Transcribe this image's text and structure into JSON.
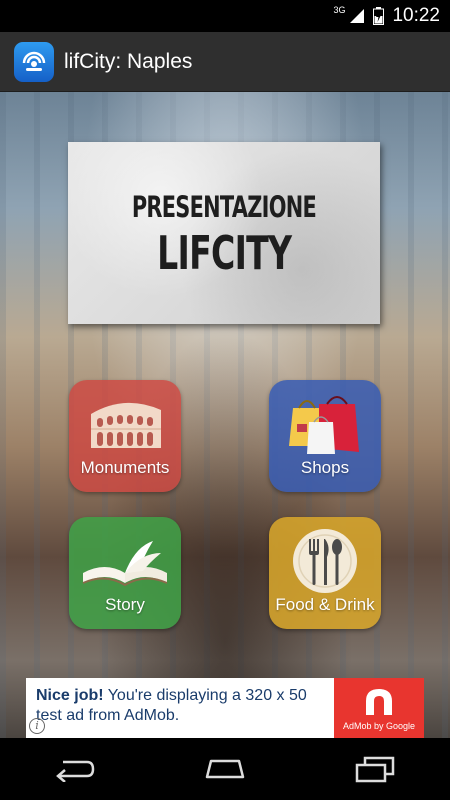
{
  "status_bar": {
    "network": "3G",
    "time": "10:22"
  },
  "app": {
    "title": "lifCity: Naples"
  },
  "presentation": {
    "line1": "PRESENTAZIONE",
    "line2": "LIFCITY"
  },
  "tiles": [
    {
      "label": "Monuments",
      "icon": "colosseum-icon",
      "color": "#ce4842"
    },
    {
      "label": "Shops",
      "icon": "shopping-bags-icon",
      "color": "#375cb4"
    },
    {
      "label": "Story",
      "icon": "open-book-icon",
      "color": "#40a246"
    },
    {
      "label": "Food & Drink",
      "icon": "plate-cutlery-icon",
      "color": "#daa82a"
    }
  ],
  "ad": {
    "headline": "Nice job!",
    "body": "You're displaying a 320 x 50 test ad from AdMob.",
    "logo_caption": "AdMob by Google",
    "info": "i"
  }
}
